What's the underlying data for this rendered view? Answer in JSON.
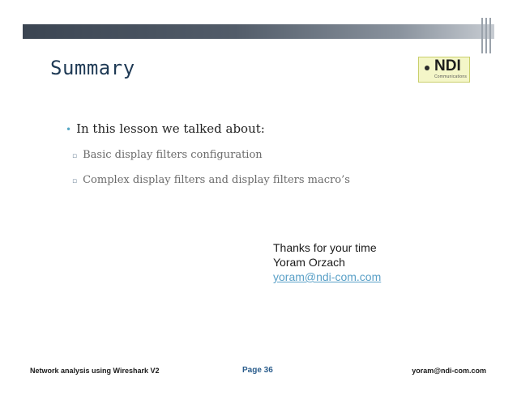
{
  "slide": {
    "title": "Summary",
    "logo_text": "NDI",
    "logo_sub": "Communications"
  },
  "content": {
    "main_bullet": "In this lesson we talked about:",
    "sub_bullets": [
      "Basic display filters configuration",
      "Complex display filters and display filters macro’s"
    ]
  },
  "closing": {
    "thanks": "Thanks for your time",
    "name": "Yoram Orzach",
    "email": "yoram@ndi-com.com"
  },
  "footer": {
    "left": "Network analysis using Wireshark V2",
    "page": "Page 36",
    "right": "yoram@ndi-com.com"
  }
}
